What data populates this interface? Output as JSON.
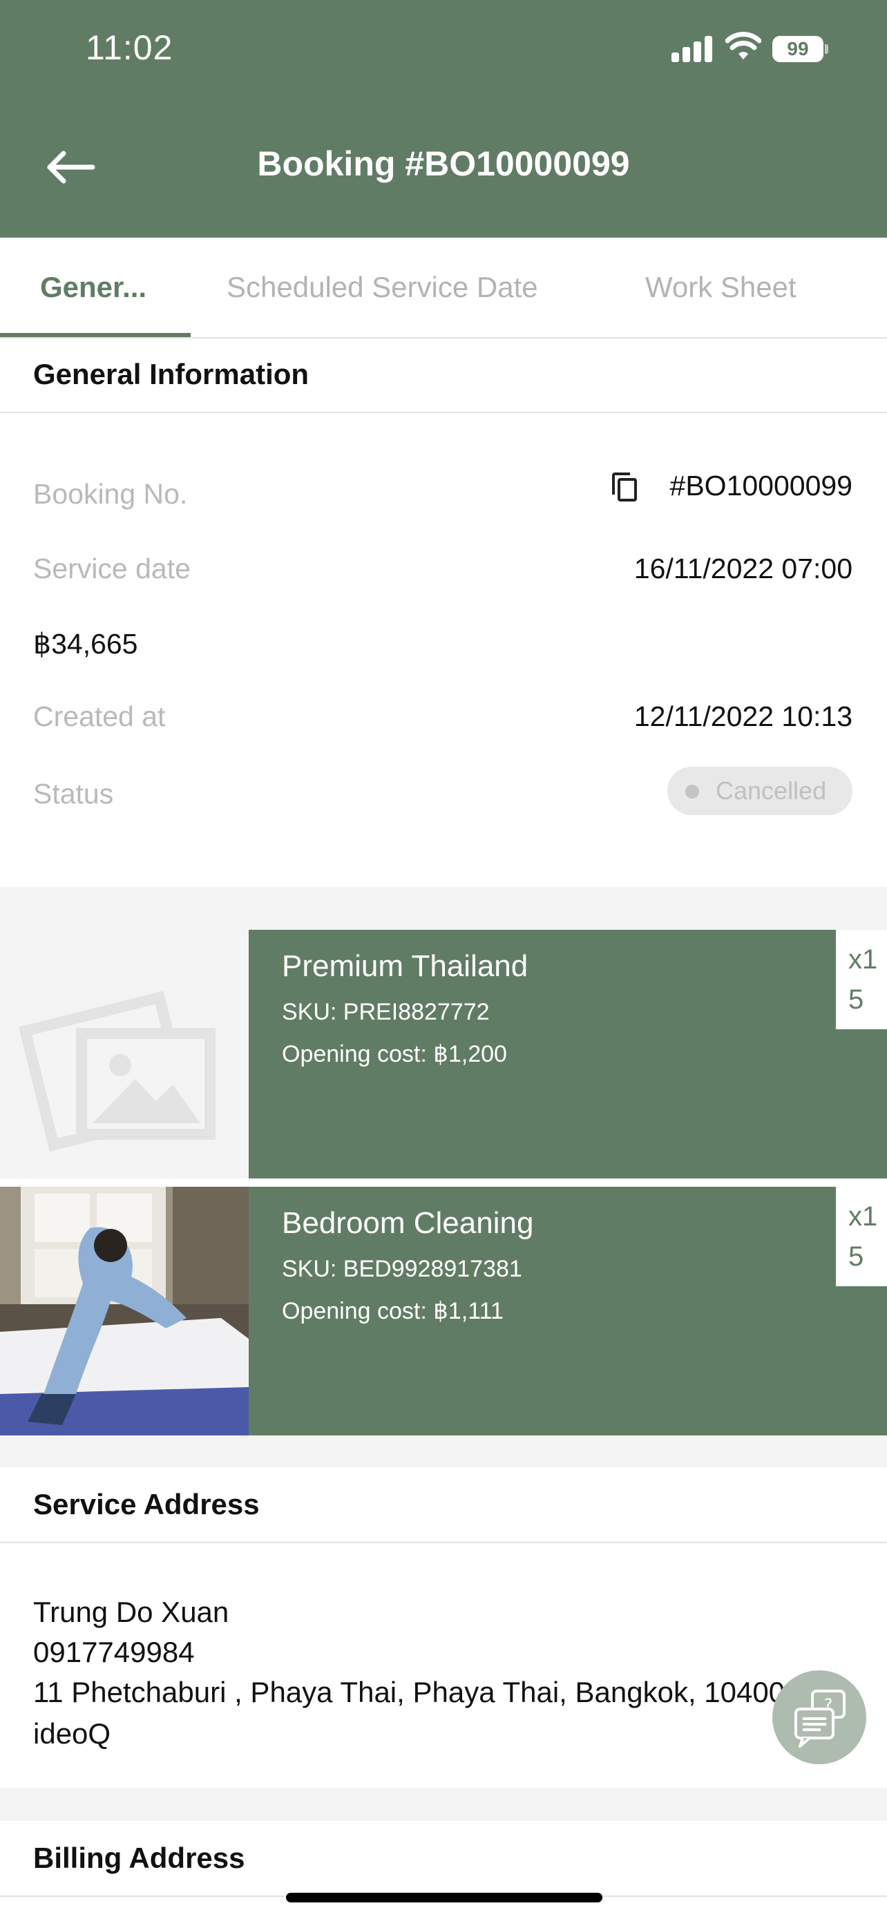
{
  "status_bar": {
    "time": "11:02",
    "battery": "99"
  },
  "header": {
    "title": "Booking #BO10000099"
  },
  "tabs": [
    {
      "label": "Gener..."
    },
    {
      "label": "Scheduled Service Date"
    },
    {
      "label": "Work Sheet"
    }
  ],
  "general": {
    "section_title": "General Information",
    "booking_no_label": "Booking No.",
    "booking_no_value": "#BO10000099",
    "service_date_label": "Service date",
    "service_date_value": "16/11/2022 07:00",
    "amount": "฿34,665",
    "created_at_label": "Created at",
    "created_at_value": "12/11/2022 10:13",
    "status_label": "Status",
    "status_value": "Cancelled"
  },
  "products": [
    {
      "name": "Premium Thailand",
      "sku": "SKU: PREI8827772",
      "cost": "Opening cost: ฿1,200",
      "qty": "x15"
    },
    {
      "name": "Bedroom Cleaning",
      "sku": "SKU: BED9928917381",
      "cost": "Opening cost: ฿1,111",
      "qty": "x15"
    }
  ],
  "service_address": {
    "section_title": "Service Address",
    "name": "Trung Do Xuan",
    "phone": "0917749984",
    "address": "11 Phetchaburi , Phaya Thai, Phaya Thai, Bangkok, 10400",
    "company": "ideoQ"
  },
  "billing_address": {
    "section_title": "Billing Address"
  },
  "colors": {
    "primary": "#617c64",
    "muted_text": "#b9b9b9",
    "band": "#f4f4f4"
  }
}
